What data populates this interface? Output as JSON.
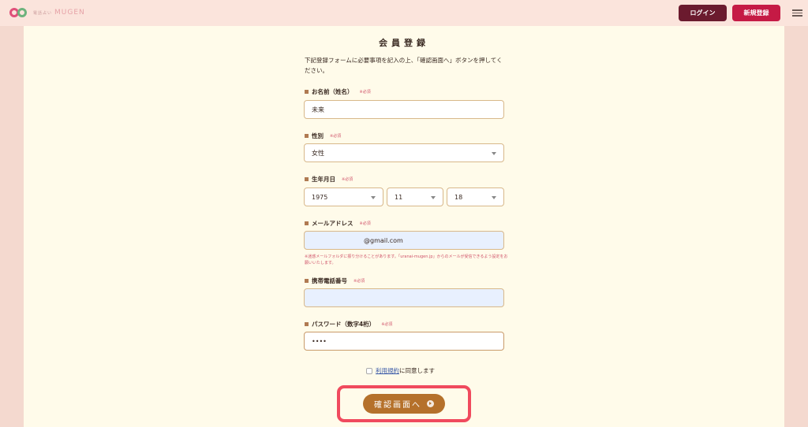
{
  "header": {
    "logo_sub": "電話占い",
    "logo_text": "MUGEN",
    "login_label": "ログイン",
    "register_label": "新規登録"
  },
  "form": {
    "title": "会員登録",
    "intro": "下記登録フォームに必要事項を記入の上、「確認画面へ」ボタンを押してください。",
    "required": "※必須",
    "name": {
      "label": "お名前（姓名）",
      "value": "未来"
    },
    "gender": {
      "label": "性別",
      "value": "女性"
    },
    "birthdate": {
      "label": "生年月日",
      "year": "1975",
      "month": "11",
      "day": "18"
    },
    "email": {
      "label": "メールアドレス",
      "value": "@gmail.com",
      "note": "※迷惑メールフォルダに振り分けることがあります。「uranai-mugen.jp」からのメールが受信できるよう設定をお願いいたします。"
    },
    "phone": {
      "label": "携帯電話番号",
      "value": ""
    },
    "password": {
      "label": "パスワード（数字4桁）",
      "value": "••••"
    },
    "agree": {
      "link": "利用規約",
      "text": "に同意します"
    },
    "confirm_label": "確認画面へ"
  }
}
